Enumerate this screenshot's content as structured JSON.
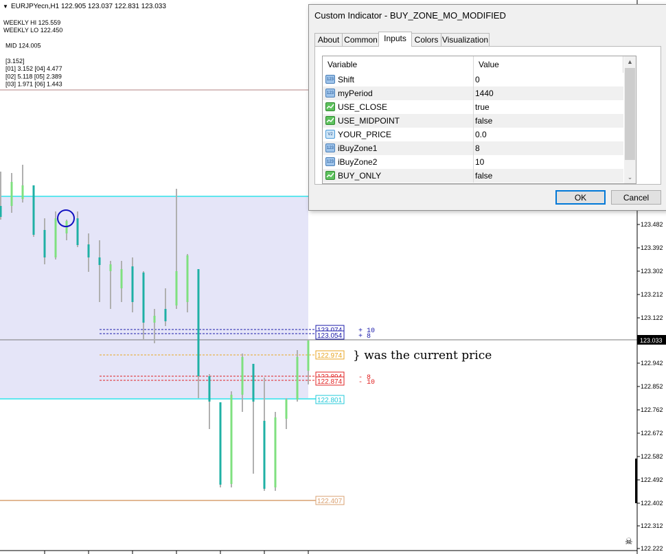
{
  "chart": {
    "symbol_header": "EURJPYecn,H1  122.905 123.037 122.831 123.033",
    "info_lines": [
      "WEEKLY HI 125.559",
      "WEEKLY LO 122.450",
      "",
      "MID 124.005",
      "",
      "[3.152]",
      "[01] 3.152  [04] 4.477",
      "[02] 5.118  [05] 2.389",
      "[03] 1.971  [06] 1.443"
    ],
    "annotation": "} was the current price",
    "price_axis": {
      "ticks": [
        "123.482",
        "123.392",
        "123.302",
        "123.212",
        "123.122",
        "122.942",
        "122.852",
        "122.762",
        "122.672",
        "122.582",
        "122.492",
        "122.402",
        "122.312",
        "122.222"
      ],
      "current": "123.033"
    },
    "levels": [
      {
        "label": "123.074",
        "color": "#1a1aaa",
        "tag": "+ 10"
      },
      {
        "label": "123.054",
        "color": "#1a1aaa",
        "tag": "+ 8"
      },
      {
        "label": "122.974",
        "color": "#e8a623",
        "tag": ""
      },
      {
        "label": "122.894",
        "color": "#e02020",
        "tag": "- 8"
      },
      {
        "label": "122.874",
        "color": "#e02020",
        "tag": "- 10"
      },
      {
        "label": "122.801",
        "color": "#21c8d8",
        "tag": ""
      },
      {
        "label": "122.407",
        "color": "#d9a070",
        "tag": ""
      }
    ],
    "colors": {
      "zone_fill": "#e5e5f8",
      "zone_border": "#5ee6ee",
      "bull": "#7fe07f",
      "bear": "#1fb0a5",
      "wick": "#b0b0b0"
    }
  },
  "dialog": {
    "title": "Custom Indicator - BUY_ZONE_MO_MODIFIED",
    "tabs": [
      "About",
      "Common",
      "Inputs",
      "Colors",
      "Visualization"
    ],
    "active_tab": "Inputs",
    "columns": [
      "Variable",
      "Value"
    ],
    "rows": [
      {
        "name": "Shift",
        "value": "0",
        "icon": "int-icon",
        "badge": "123"
      },
      {
        "name": "myPeriod",
        "value": "1440",
        "icon": "int-icon",
        "badge": "123"
      },
      {
        "name": "USE_CLOSE",
        "value": "true",
        "icon": "bool-icon",
        "badge": ""
      },
      {
        "name": "USE_MIDPOINT",
        "value": "false",
        "icon": "bool-icon",
        "badge": ""
      },
      {
        "name": "YOUR_PRICE",
        "value": "0.0",
        "icon": "double-icon",
        "badge": "V2"
      },
      {
        "name": "iBuyZone1",
        "value": "8",
        "icon": "int-icon",
        "badge": "123"
      },
      {
        "name": "iBuyZone2",
        "value": "10",
        "icon": "int-icon",
        "badge": "123"
      },
      {
        "name": "BUY_ONLY",
        "value": "false",
        "icon": "bool-icon",
        "badge": ""
      }
    ],
    "ok_label": "OK",
    "cancel_label": "Cancel"
  }
}
